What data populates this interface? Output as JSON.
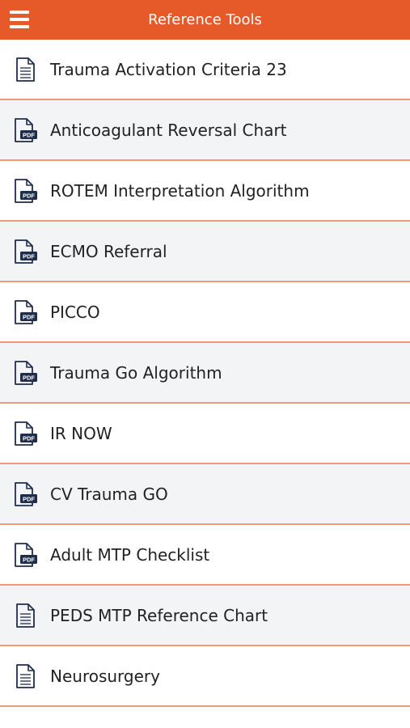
{
  "header": {
    "title": "Reference Tools",
    "menu_icon": "hamburger-menu-icon"
  },
  "colors": {
    "accent": "#e55a28",
    "divider": "#ef9a78",
    "alt_row": "#f3f4f6",
    "icon": "#1f2d4d"
  },
  "items": [
    {
      "label": "Trauma Activation Criteria 23",
      "icon": "document-icon"
    },
    {
      "label": "Anticoagulant Reversal Chart",
      "icon": "pdf-file-icon"
    },
    {
      "label": "ROTEM Interpretation Algorithm",
      "icon": "pdf-file-icon"
    },
    {
      "label": "ECMO Referral",
      "icon": "pdf-file-icon"
    },
    {
      "label": "PICCO",
      "icon": "pdf-file-icon"
    },
    {
      "label": "Trauma Go Algorithm",
      "icon": "pdf-file-icon"
    },
    {
      "label": "IR NOW",
      "icon": "pdf-file-icon"
    },
    {
      "label": "CV Trauma GO",
      "icon": "pdf-file-icon"
    },
    {
      "label": "Adult MTP Checklist",
      "icon": "pdf-file-icon"
    },
    {
      "label": "PEDS MTP Reference Chart",
      "icon": "document-icon"
    },
    {
      "label": "Neurosurgery",
      "icon": "document-icon"
    }
  ]
}
